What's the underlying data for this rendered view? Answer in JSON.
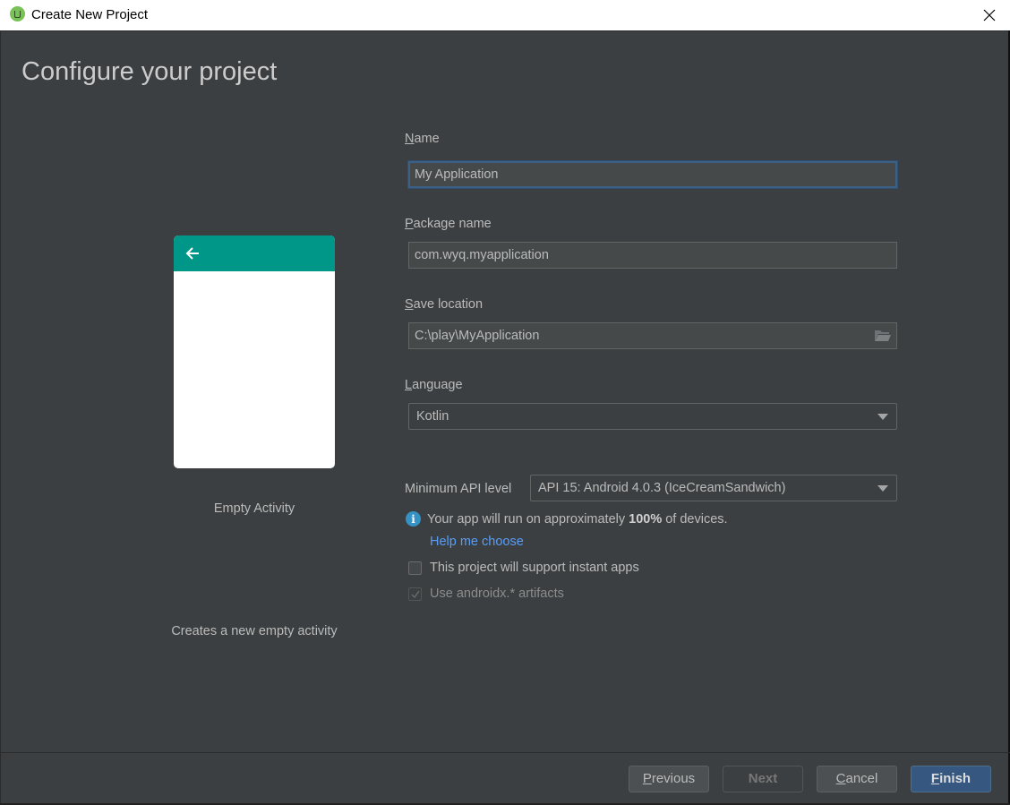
{
  "window": {
    "title": "Create New Project",
    "app_icon": "android-studio-icon",
    "close_icon": "close-icon"
  },
  "page": {
    "title": "Configure your project"
  },
  "template": {
    "name": "Empty Activity",
    "description": "Creates a new empty activity",
    "preview_colors": {
      "appbar": "#009688",
      "body": "#ffffff"
    }
  },
  "form": {
    "name": {
      "mnemonic": "N",
      "label_rest": "ame",
      "value": "My Application"
    },
    "package_name": {
      "mnemonic": "P",
      "label_rest": "ackage name",
      "value": "com.wyq.myapplication"
    },
    "save_location": {
      "mnemonic": "S",
      "label_rest": "ave location",
      "value": "C:\\play\\MyApplication"
    },
    "language": {
      "mnemonic": "L",
      "label_rest": "anguage",
      "selected": "Kotlin"
    },
    "min_api": {
      "label": "Minimum API level",
      "selected": "API 15: Android 4.0.3 (IceCreamSandwich)"
    },
    "info": {
      "prefix": "Your app will run on approximately",
      "percent": "100%",
      "suffix": "of devices."
    },
    "help_link": "Help me choose",
    "instant_apps": {
      "label": "This project will support instant apps",
      "checked": false
    },
    "androidx": {
      "label": "Use androidx.* artifacts",
      "checked": true,
      "disabled": true
    }
  },
  "footer": {
    "previous": {
      "mnemonic": "P",
      "rest": "revious",
      "enabled": true
    },
    "next": {
      "label": "Next",
      "enabled": false
    },
    "cancel": {
      "mnemonic": "C",
      "rest": "ancel",
      "enabled": true
    },
    "finish": {
      "mnemonic": "F",
      "rest": "inish",
      "enabled": true,
      "primary": true
    }
  },
  "colors": {
    "background": "#3c3f41",
    "accent": "#365880",
    "link": "#589df6",
    "info": "#3592c4",
    "focus_border": "#3d6185"
  }
}
